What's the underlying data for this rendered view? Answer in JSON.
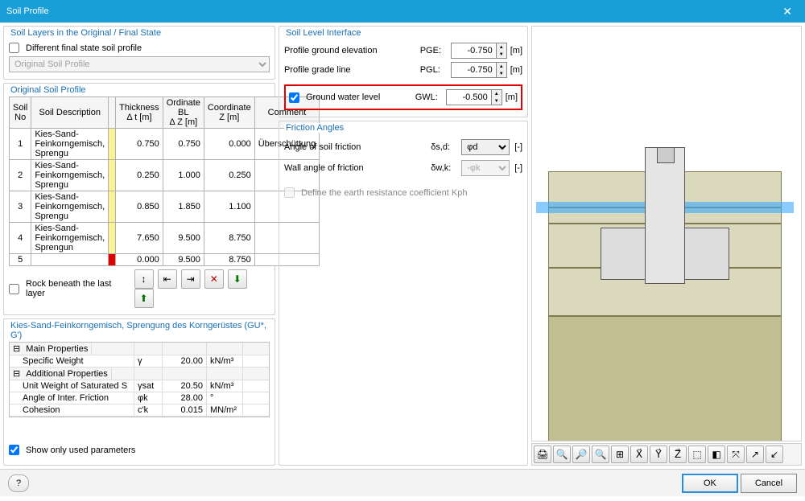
{
  "window": {
    "title": "Soil Profile"
  },
  "soil_layers_group": {
    "title": "Soil Layers in the Original / Final State",
    "diff_final_label": "Different final state soil profile",
    "diff_final_checked": false,
    "profile_combo": "Original Soil Profile"
  },
  "soil_level_group": {
    "title": "Soil Level Interface",
    "pge_label": "Profile ground elevation",
    "pge_sym": "PGE:",
    "pge_val": "-0.750",
    "pge_unit": "[m]",
    "pgl_label": "Profile grade line",
    "pgl_sym": "PGL:",
    "pgl_val": "-0.750",
    "pgl_unit": "[m]",
    "gwl_label": "Ground water level",
    "gwl_sym": "GWL:",
    "gwl_val": "-0.500",
    "gwl_unit": "[m]",
    "gwl_checked": true
  },
  "original_profile": {
    "title": "Original Soil Profile",
    "headers": {
      "soil_no": "Soil\nNo",
      "desc": "Soil Description",
      "thick": "Thickness\nΔ t [m]",
      "ord": "Ordinate BL\nΔ Z [m]",
      "coord": "Coordinate\nZ [m]",
      "comment": "Comment"
    },
    "rows": [
      {
        "no": "1",
        "desc": "Kies-Sand-Feinkorngemisch, Sprengu",
        "color": "yellow",
        "t": "0.750",
        "z": "0.750",
        "zz": "0.000",
        "c": "Überschüttung"
      },
      {
        "no": "2",
        "desc": "Kies-Sand-Feinkorngemisch, Sprengu",
        "color": "yellow",
        "t": "0.250",
        "z": "1.000",
        "zz": "0.250",
        "c": ""
      },
      {
        "no": "3",
        "desc": "Kies-Sand-Feinkorngemisch, Sprengu",
        "color": "yellow",
        "t": "0.850",
        "z": "1.850",
        "zz": "1.100",
        "c": ""
      },
      {
        "no": "4",
        "desc": "Kies-Sand-Feinkorngemisch, Sprengun",
        "color": "yellow",
        "t": "7.650",
        "z": "9.500",
        "zz": "8.750",
        "c": ""
      },
      {
        "no": "5",
        "desc": "",
        "color": "red",
        "t": "0.000",
        "z": "9.500",
        "zz": "8.750",
        "c": ""
      }
    ],
    "rock_label": "Rock beneath the last layer",
    "rock_checked": false
  },
  "toolbar_icons": {
    "lib": "↕",
    "left": "⇤",
    "right": "⇥",
    "del": "✕",
    "xls_in": "⬇",
    "xls_out": "⬆"
  },
  "soil_props": {
    "title": "Kies-Sand-Feinkorngemisch, Sprengung des Korngerüstes (GU*, G')",
    "main_title": "Main Properties",
    "add_title": "Additional Properties",
    "rows": {
      "spec_weight": {
        "label": "Specific Weight",
        "sym": "γ",
        "val": "20.00",
        "unit": "kN/m³"
      },
      "unit_sat": {
        "label": "Unit Weight of Saturated S",
        "sym": "γsat",
        "val": "20.50",
        "unit": "kN/m³"
      },
      "inter_fric": {
        "label": "Angle of Inter. Friction",
        "sym": "φk",
        "val": "28.00",
        "unit": "°"
      },
      "cohesion": {
        "label": "Cohesion",
        "sym": "c'k",
        "val": "0.015",
        "unit": "MN/m²"
      }
    },
    "show_used_label": "Show only used parameters",
    "show_used_checked": true
  },
  "friction": {
    "title": "Friction Angles",
    "soil_label": "Angle of soil friction",
    "soil_sym": "δs,d:",
    "soil_val": "φd",
    "soil_unit": "[-]",
    "wall_label": "Wall angle of friction",
    "wall_sym": "δw,k:",
    "wall_val": "-φk",
    "wall_unit": "[-]",
    "kph_label": "Define the earth resistance coefficient Kph",
    "kph_checked": false
  },
  "viewer_icons": [
    "🖨",
    "🔍",
    "🔎",
    "🔍",
    "⊞",
    "X⃗",
    "Y⃗",
    "Z⃗",
    "⬚",
    "◧",
    "⤧",
    "↗",
    "↙"
  ],
  "footer": {
    "ok": "OK",
    "cancel": "Cancel",
    "help": "?"
  }
}
